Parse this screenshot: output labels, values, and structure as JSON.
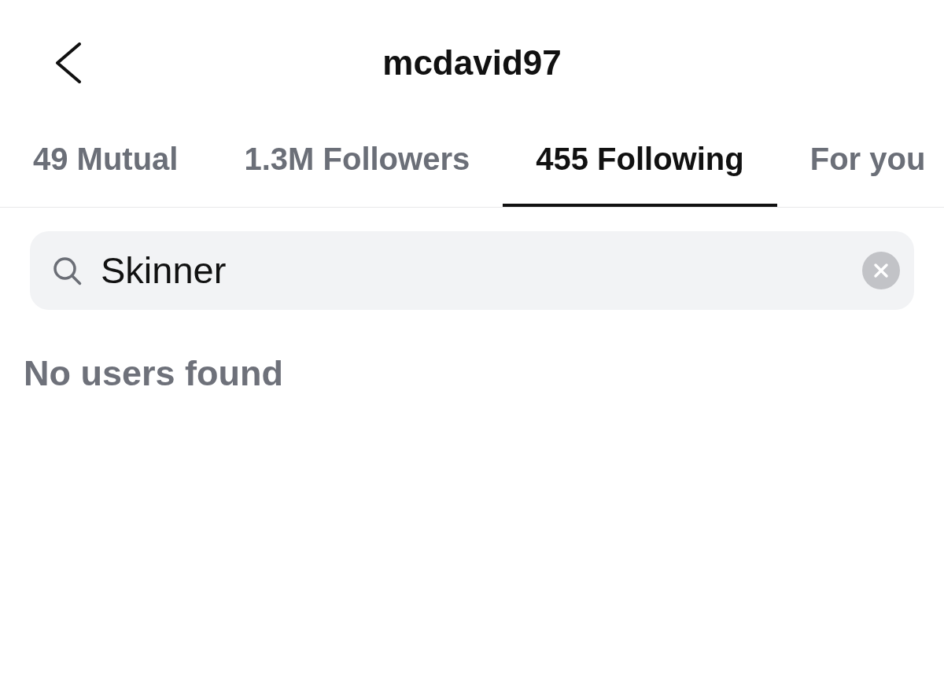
{
  "header": {
    "title": "mcdavid97"
  },
  "tabs": [
    {
      "label": "49 Mutual",
      "selected": false
    },
    {
      "label": "1.3M Followers",
      "selected": false
    },
    {
      "label": "455 Following",
      "selected": true
    },
    {
      "label": "For you",
      "selected": false
    }
  ],
  "search": {
    "value": "Skinner"
  },
  "results": {
    "message": "No users found"
  }
}
